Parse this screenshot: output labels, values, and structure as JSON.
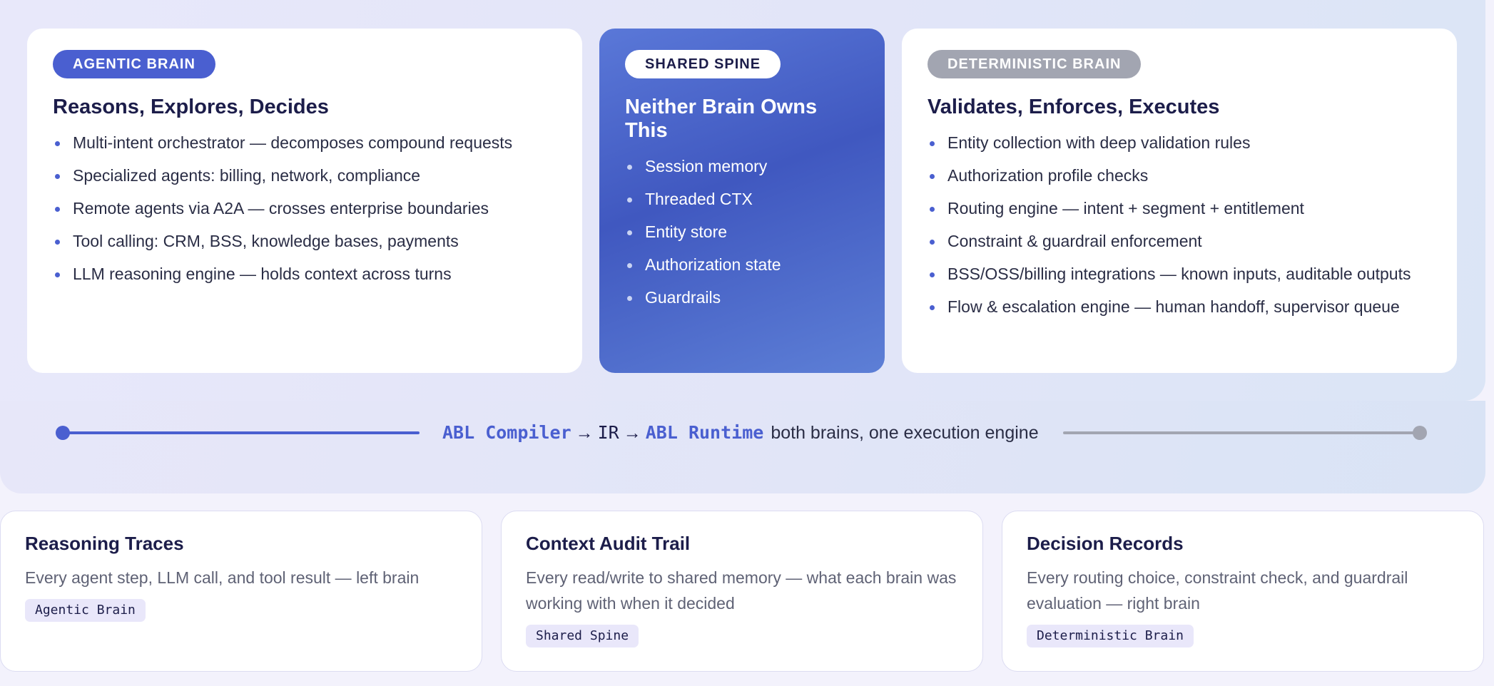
{
  "cards": {
    "agentic": {
      "pill": "AGENTIC BRAIN",
      "title": "Reasons, Explores, Decides",
      "items": [
        "Multi-intent orchestrator — decomposes compound requests",
        "Specialized agents: billing, network, compliance",
        "Remote agents via A2A — crosses enterprise boundaries",
        "Tool calling: CRM, BSS, knowledge bases, payments",
        "LLM reasoning engine — holds context across turns"
      ]
    },
    "shared": {
      "pill": "SHARED SPINE",
      "title": "Neither Brain Owns This",
      "items": [
        "Session memory",
        "Threaded CTX",
        "Entity store",
        "Authorization state",
        "Guardrails"
      ]
    },
    "deterministic": {
      "pill": "DETERMINISTIC BRAIN",
      "title": "Validates, Enforces, Executes",
      "items": [
        "Entity collection with deep validation rules",
        "Authorization profile checks",
        "Routing engine — intent + segment + entitlement",
        "Constraint & guardrail enforcement",
        "BSS/OSS/billing integrations — known inputs, auditable outputs",
        "Flow & escalation engine — human handoff, supervisor queue"
      ]
    }
  },
  "pipeline": {
    "compiler": "ABL Compiler",
    "arrow": "→",
    "ir": "IR",
    "runtime": "ABL Runtime",
    "tagline": "both brains, one execution engine"
  },
  "bottom": [
    {
      "title": "Reasoning Traces",
      "desc": "Every agent step, LLM call, and tool result — left brain",
      "tag": "Agentic Brain"
    },
    {
      "title": "Context Audit Trail",
      "desc": "Every read/write to shared memory — what each brain was working with when it decided",
      "tag": "Shared Spine"
    },
    {
      "title": "Decision Records",
      "desc": "Every routing choice, constraint check, and guardrail evaluation — right brain",
      "tag": "Deterministic Brain"
    }
  ],
  "colors": {
    "agentic": "#4a5fd0",
    "deterministic": "#a2a5b1",
    "shared_bg": "#4a63c8",
    "title": "#1c1d4a"
  }
}
